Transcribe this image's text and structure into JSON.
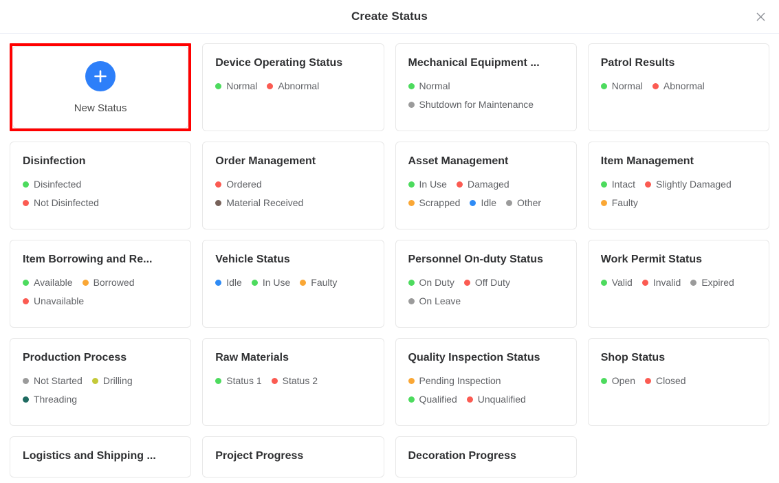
{
  "dialog": {
    "title": "Create Status",
    "close_icon": "close-icon"
  },
  "new_status": {
    "label": "New Status",
    "icon": "plus-icon",
    "accent_color": "#2d7ff9",
    "highlight_color": "#ff0000"
  },
  "colors": {
    "green": "#4ddb5e",
    "red": "#fb5b52",
    "orange": "#faa735",
    "blue": "#2e8bf5",
    "gray": "#9b9b9b",
    "brown": "#77625a",
    "olive": "#c4c938",
    "teal": "#1f6b61"
  },
  "cards": [
    {
      "title": "Device Operating Status",
      "rows": [
        [
          {
            "label": "Normal",
            "color": "#4ddb5e"
          },
          {
            "label": "Abnormal",
            "color": "#fb5b52"
          }
        ]
      ]
    },
    {
      "title": "Mechanical Equipment ...",
      "rows": [
        [
          {
            "label": "Normal",
            "color": "#4ddb5e"
          }
        ],
        [
          {
            "label": "Shutdown for Maintenance",
            "color": "#9b9b9b"
          }
        ]
      ]
    },
    {
      "title": "Patrol Results",
      "rows": [
        [
          {
            "label": "Normal",
            "color": "#4ddb5e"
          },
          {
            "label": "Abnormal",
            "color": "#fb5b52"
          }
        ]
      ]
    },
    {
      "title": "Disinfection",
      "rows": [
        [
          {
            "label": "Disinfected",
            "color": "#4ddb5e"
          }
        ],
        [
          {
            "label": "Not Disinfected",
            "color": "#fb5b52"
          }
        ]
      ]
    },
    {
      "title": "Order Management",
      "rows": [
        [
          {
            "label": "Ordered",
            "color": "#fb5b52"
          }
        ],
        [
          {
            "label": "Material Received",
            "color": "#77625a"
          }
        ]
      ]
    },
    {
      "title": "Asset Management",
      "rows": [
        [
          {
            "label": "In Use",
            "color": "#4ddb5e"
          },
          {
            "label": "Damaged",
            "color": "#fb5b52"
          }
        ],
        [
          {
            "label": "Scrapped",
            "color": "#faa735"
          },
          {
            "label": "Idle",
            "color": "#2e8bf5"
          },
          {
            "label": "Other",
            "color": "#9b9b9b"
          }
        ]
      ]
    },
    {
      "title": "Item Management",
      "rows": [
        [
          {
            "label": "Intact",
            "color": "#4ddb5e"
          },
          {
            "label": "Slightly Damaged",
            "color": "#fb5b52"
          }
        ],
        [
          {
            "label": "Faulty",
            "color": "#faa735"
          }
        ]
      ]
    },
    {
      "title": "Item Borrowing and Re...",
      "rows": [
        [
          {
            "label": "Available",
            "color": "#4ddb5e"
          },
          {
            "label": "Borrowed",
            "color": "#faa735"
          }
        ],
        [
          {
            "label": "Unavailable",
            "color": "#fb5b52"
          }
        ]
      ]
    },
    {
      "title": "Vehicle Status",
      "rows": [
        [
          {
            "label": "Idle",
            "color": "#2e8bf5"
          },
          {
            "label": "In Use",
            "color": "#4ddb5e"
          },
          {
            "label": "Faulty",
            "color": "#faa735"
          }
        ]
      ]
    },
    {
      "title": "Personnel On-duty Status",
      "rows": [
        [
          {
            "label": "On Duty",
            "color": "#4ddb5e"
          },
          {
            "label": "Off Duty",
            "color": "#fb5b52"
          }
        ],
        [
          {
            "label": "On Leave",
            "color": "#9b9b9b"
          }
        ]
      ]
    },
    {
      "title": "Work Permit Status",
      "rows": [
        [
          {
            "label": "Valid",
            "color": "#4ddb5e"
          },
          {
            "label": "Invalid",
            "color": "#fb5b52"
          },
          {
            "label": "Expired",
            "color": "#9b9b9b"
          }
        ]
      ]
    },
    {
      "title": "Production Process",
      "rows": [
        [
          {
            "label": "Not Started",
            "color": "#9b9b9b"
          },
          {
            "label": "Drilling",
            "color": "#c4c938"
          }
        ],
        [
          {
            "label": "Threading",
            "color": "#1f6b61"
          }
        ]
      ]
    },
    {
      "title": "Raw Materials",
      "rows": [
        [
          {
            "label": "Status 1",
            "color": "#4ddb5e"
          },
          {
            "label": "Status 2",
            "color": "#fb5b52"
          }
        ]
      ]
    },
    {
      "title": "Quality Inspection Status",
      "rows": [
        [
          {
            "label": "Pending Inspection",
            "color": "#faa735"
          }
        ],
        [
          {
            "label": "Qualified",
            "color": "#4ddb5e"
          },
          {
            "label": "Unqualified",
            "color": "#fb5b52"
          }
        ]
      ]
    },
    {
      "title": "Shop Status",
      "rows": [
        [
          {
            "label": "Open",
            "color": "#4ddb5e"
          },
          {
            "label": "Closed",
            "color": "#fb5b52"
          }
        ]
      ]
    },
    {
      "title": "Logistics and Shipping ...",
      "rows": []
    },
    {
      "title": "Project Progress",
      "rows": []
    },
    {
      "title": "Decoration Progress",
      "rows": []
    }
  ]
}
